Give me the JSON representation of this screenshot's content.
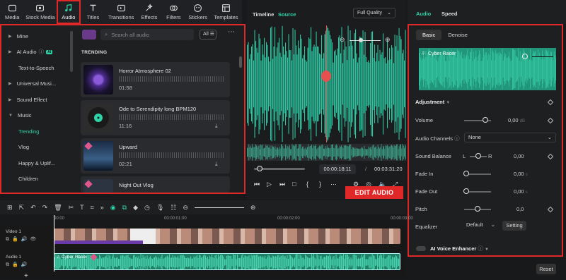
{
  "toolbar": {
    "items": [
      {
        "label": "Media",
        "icon": "media-icon"
      },
      {
        "label": "Stock Media",
        "icon": "stock-media-icon"
      },
      {
        "label": "Audio",
        "icon": "music-note-icon"
      },
      {
        "label": "Titles",
        "icon": "titles-icon"
      },
      {
        "label": "Transitions",
        "icon": "transitions-icon"
      },
      {
        "label": "Effects",
        "icon": "effects-icon"
      },
      {
        "label": "Filters",
        "icon": "filters-icon"
      },
      {
        "label": "Stickers",
        "icon": "stickers-icon"
      },
      {
        "label": "Templates",
        "icon": "templates-icon"
      }
    ]
  },
  "sidebar": {
    "items": [
      {
        "label": "Mine"
      },
      {
        "label": "AI Audio",
        "badge": "AI"
      },
      {
        "label": "Text-to-Speech"
      },
      {
        "label": "Universal Musi..."
      },
      {
        "label": "Sound Effect"
      },
      {
        "label": "Music"
      },
      {
        "label": "Trending"
      },
      {
        "label": "Vlog"
      },
      {
        "label": "Happy & Uplif..."
      },
      {
        "label": "Children"
      }
    ]
  },
  "search": {
    "placeholder": "Search all audio",
    "filter": "All"
  },
  "section": "TRENDING",
  "tracks": [
    {
      "title": "Horror Atmosphere 02",
      "duration": "01:58"
    },
    {
      "title": "Ode to Serendipity long BPM120",
      "duration": "11:16"
    },
    {
      "title": "Upward",
      "duration": "02:21"
    },
    {
      "title": "Night Out Vlog",
      "duration": ""
    }
  ],
  "preview": {
    "tab1": "Timeline",
    "tab2": "Source",
    "quality": "Full Quality",
    "current": "00:00:18:11",
    "sep": "/",
    "total": "00:03:31:20",
    "progress": 0.05
  },
  "callout": "EDIT AUDIO",
  "right": {
    "tab_audio": "Audio",
    "tab_speed": "Speed",
    "basic": "Basic",
    "denoise": "Denoise",
    "clip_name": "Cyber Racer",
    "adjustment": "Adjustment",
    "volume": {
      "label": "Volume",
      "value": "0,00",
      "unit": "dB",
      "level": 0.5
    },
    "channels": {
      "label": "Audio Channels",
      "value": "None"
    },
    "balance": {
      "label": "Sound Balance",
      "l": "L",
      "r": "R",
      "value": "0,00",
      "level": 0.5
    },
    "fadein": {
      "label": "Fade In",
      "value": "0,00",
      "unit": "s"
    },
    "fadeout": {
      "label": "Fade Out",
      "value": "0,00",
      "unit": "s"
    },
    "pitch": {
      "label": "Pitch",
      "value": "0,0",
      "level": 0.5
    },
    "equalizer": {
      "label": "Equalizer",
      "value": "Default",
      "btn": "Setting"
    },
    "voice": {
      "label": "AI Voice Enhancer"
    },
    "reset": "Reset"
  },
  "timeline": {
    "ruler": [
      "00:00",
      "00:00:01:00",
      "00:00:02:00",
      "00:00:03:00",
      "00:00:04:00"
    ],
    "video_label": "Video 1",
    "audio_label": "Audio 1",
    "audio_clip": "Cyber Racer"
  },
  "colors": {
    "accent": "#2dd4a8",
    "highlight": "#e02828",
    "playhead": "#e85050"
  }
}
